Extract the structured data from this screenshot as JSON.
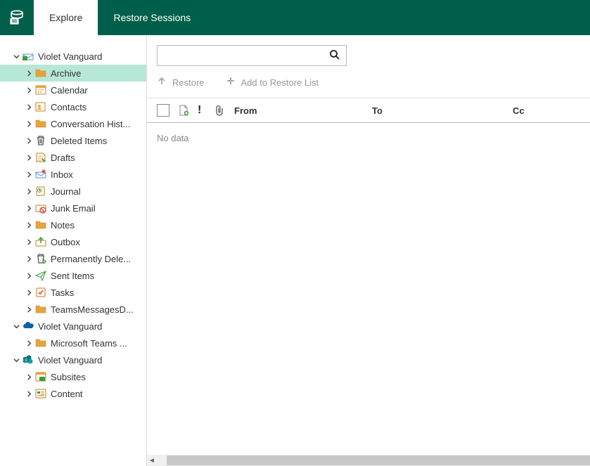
{
  "header": {
    "tabs": [
      {
        "label": "Explore",
        "active": true
      },
      {
        "label": "Restore Sessions",
        "active": false
      }
    ]
  },
  "sidebar": {
    "nodes": [
      {
        "label": "Violet Vanguard",
        "depth": 0,
        "expanded": true,
        "icon": "mailbox",
        "selected": false
      },
      {
        "label": "Archive",
        "depth": 1,
        "expanded": false,
        "icon": "folder",
        "selected": true
      },
      {
        "label": "Calendar",
        "depth": 1,
        "expanded": false,
        "icon": "calendar",
        "selected": false
      },
      {
        "label": "Contacts",
        "depth": 1,
        "expanded": false,
        "icon": "contacts",
        "selected": false
      },
      {
        "label": "Conversation Hist...",
        "depth": 1,
        "expanded": false,
        "icon": "folder",
        "selected": false
      },
      {
        "label": "Deleted Items",
        "depth": 1,
        "expanded": false,
        "icon": "trash",
        "selected": false
      },
      {
        "label": "Drafts",
        "depth": 1,
        "expanded": false,
        "icon": "drafts",
        "selected": false
      },
      {
        "label": "Inbox",
        "depth": 1,
        "expanded": false,
        "icon": "inbox",
        "selected": false
      },
      {
        "label": "Journal",
        "depth": 1,
        "expanded": false,
        "icon": "journal",
        "selected": false
      },
      {
        "label": "Junk Email",
        "depth": 1,
        "expanded": false,
        "icon": "junk",
        "selected": false
      },
      {
        "label": "Notes",
        "depth": 1,
        "expanded": false,
        "icon": "folder",
        "selected": false
      },
      {
        "label": "Outbox",
        "depth": 1,
        "expanded": false,
        "icon": "outbox",
        "selected": false
      },
      {
        "label": "Permanently Dele...",
        "depth": 1,
        "expanded": false,
        "icon": "trash-arrow",
        "selected": false
      },
      {
        "label": "Sent Items",
        "depth": 1,
        "expanded": false,
        "icon": "sent",
        "selected": false
      },
      {
        "label": "Tasks",
        "depth": 1,
        "expanded": false,
        "icon": "tasks",
        "selected": false
      },
      {
        "label": "TeamsMessagesD...",
        "depth": 1,
        "expanded": false,
        "icon": "folder",
        "selected": false
      },
      {
        "label": "Violet Vanguard",
        "depth": 0,
        "expanded": true,
        "icon": "onedrive",
        "selected": false
      },
      {
        "label": "Microsoft Teams ...",
        "depth": 1,
        "expanded": false,
        "icon": "folder",
        "selected": false
      },
      {
        "label": "Violet Vanguard",
        "depth": 0,
        "expanded": true,
        "icon": "sharepoint",
        "selected": false
      },
      {
        "label": "Subsites",
        "depth": 1,
        "expanded": false,
        "icon": "subsites",
        "selected": false
      },
      {
        "label": "Content",
        "depth": 1,
        "expanded": false,
        "icon": "content",
        "selected": false
      }
    ]
  },
  "content": {
    "search_placeholder": "",
    "toolbar": {
      "restore_label": "Restore",
      "add_label": "Add to Restore List"
    },
    "columns": {
      "from": "From",
      "to": "To",
      "cc": "Cc"
    },
    "empty_text": "No data"
  }
}
